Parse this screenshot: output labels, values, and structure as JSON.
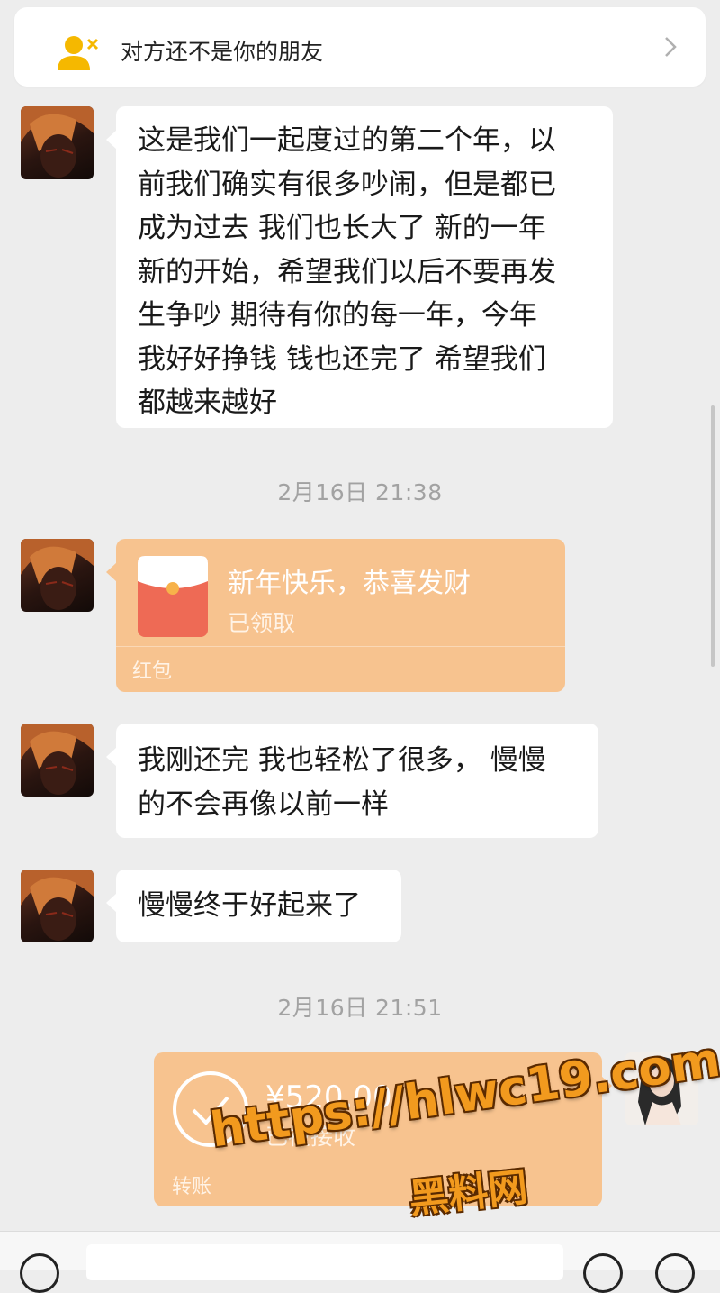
{
  "banner": {
    "text": "对方还不是你的朋友",
    "icon": "person-x-icon"
  },
  "messages": [
    {
      "type": "text",
      "lines": [
        "这是我们一起度过的第二个年，以",
        "前我们确实有很多吵闹，但是都已",
        "成为过去 我们也长大了 新的一年",
        "新的开始，希望我们以后不要再发",
        "生争吵 期待有你的每一年，今年",
        "我好好挣钱 钱也还完了 希望我们",
        "都越来越好"
      ]
    },
    {
      "type": "time",
      "text": "2月16日 21:38"
    },
    {
      "type": "red_packet",
      "title": "新年快乐，恭喜发财",
      "status": "已领取",
      "label": "红包"
    },
    {
      "type": "text",
      "lines": [
        "我刚还完 我也轻松了很多， 慢慢",
        "的不会再像以前一样"
      ]
    },
    {
      "type": "text",
      "lines": [
        "慢慢终于好起来了"
      ]
    },
    {
      "type": "time",
      "text": "2月16日 21:51"
    },
    {
      "type": "transfer",
      "amount": "¥520.00",
      "status": "已被接收",
      "label": "转账"
    }
  ],
  "watermark": {
    "url": "https://hlwc19.com",
    "site": "黑料网"
  },
  "colors": {
    "bg": "#ededed",
    "bubble": "#ffffff",
    "transfer": "#f7c38f",
    "banner_icon": "#f5b800"
  }
}
